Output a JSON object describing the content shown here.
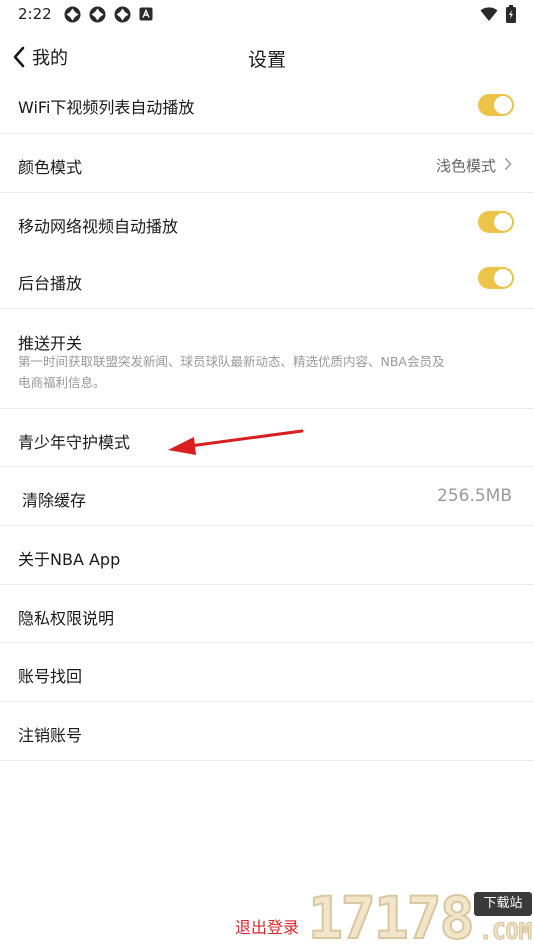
{
  "status_bar": {
    "time": "2:22",
    "left_icons": [
      "notification-icon",
      "notification-icon",
      "notification-icon",
      "app-icon"
    ],
    "right_icons": [
      "wifi-icon",
      "battery-icon"
    ]
  },
  "nav": {
    "back_label": "我的",
    "title": "设置"
  },
  "rows": [
    {
      "label": "WiFi下视频列表自动播放",
      "type": "toggle",
      "on": true
    },
    {
      "label": "颜色模式",
      "type": "value",
      "value": "浅色模式"
    },
    {
      "label": "移动网络视频自动播放",
      "type": "toggle",
      "on": true
    },
    {
      "label": "后台播放",
      "type": "toggle",
      "on": true
    },
    {
      "label": "推送开关",
      "type": "subtitle",
      "subtitle_line1": "第一时间获取联盟突发新闻、球员球队最新动态、精选优质内容、NBA会员及",
      "subtitle_line2": "电商福利信息。"
    },
    {
      "label": "青少年守护模式",
      "type": "link"
    },
    {
      "label": "清除缓存",
      "type": "value_plain",
      "value": "256.5MB"
    },
    {
      "label": "关于NBA App",
      "type": "link"
    },
    {
      "label": "隐私权限说明",
      "type": "link"
    },
    {
      "label": "账号找回",
      "type": "link"
    },
    {
      "label": "注销账号",
      "type": "link"
    }
  ],
  "logout_label": "退出登录",
  "watermark": {
    "digits": "17178",
    "badge": "下载站",
    "suffix": ".COM"
  },
  "colors": {
    "toggle_on": "#ecc447",
    "logout": "#e0262b",
    "annotation_arrow": "#d81e1e"
  }
}
